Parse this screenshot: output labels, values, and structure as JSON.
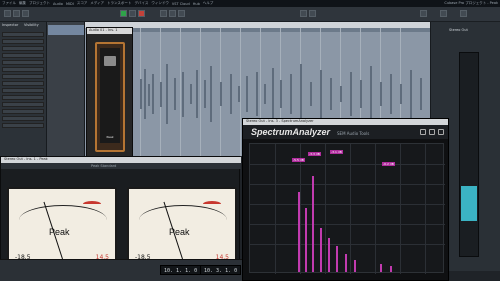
{
  "menu": {
    "items": [
      "ファイル",
      "編集",
      "プロジェクト",
      "Audio",
      "MIDI",
      "スコア",
      "メディア",
      "トランスポート",
      "デバイス",
      "ウィンドウ",
      "VST Cloud",
      "Hub",
      "ヘルプ"
    ],
    "title": "Cubase Pro プロジェクト - Peak"
  },
  "inspector": {
    "tab_inspector": "Inspector",
    "tab_visibility": "Visibility"
  },
  "plugin_small": {
    "title": "Audio 01 - Ins. 1",
    "mic_label": "Peak"
  },
  "meters": {
    "window_title": "Stereo Out - Ins. 1 - Peak",
    "preset": "Peak Standard",
    "left": {
      "label": "Peak",
      "value_left": "-18.5",
      "value_right": "14.5"
    },
    "right": {
      "label": "Peak",
      "value_left": "-18.5",
      "value_right": "14.5"
    },
    "brand": "TSProducts"
  },
  "analyzer": {
    "window_title": "Stereo Out - Ins. 3 - SpectrumAnalyzer",
    "logo": "SpectrumAnalyzer",
    "subtitle": "SEM Audio Tools",
    "peaks": [
      "-5.5 dB",
      "-3.3 dB",
      "-3.1 dB",
      "-6.2 dB"
    ]
  },
  "transport": {
    "time_left": "10. 1. 1. 0",
    "time_mid": "10. 3. 1. 0",
    "time_right": "10. 1. 1. 0"
  },
  "right_panel": {
    "label": "Stereo Out"
  }
}
